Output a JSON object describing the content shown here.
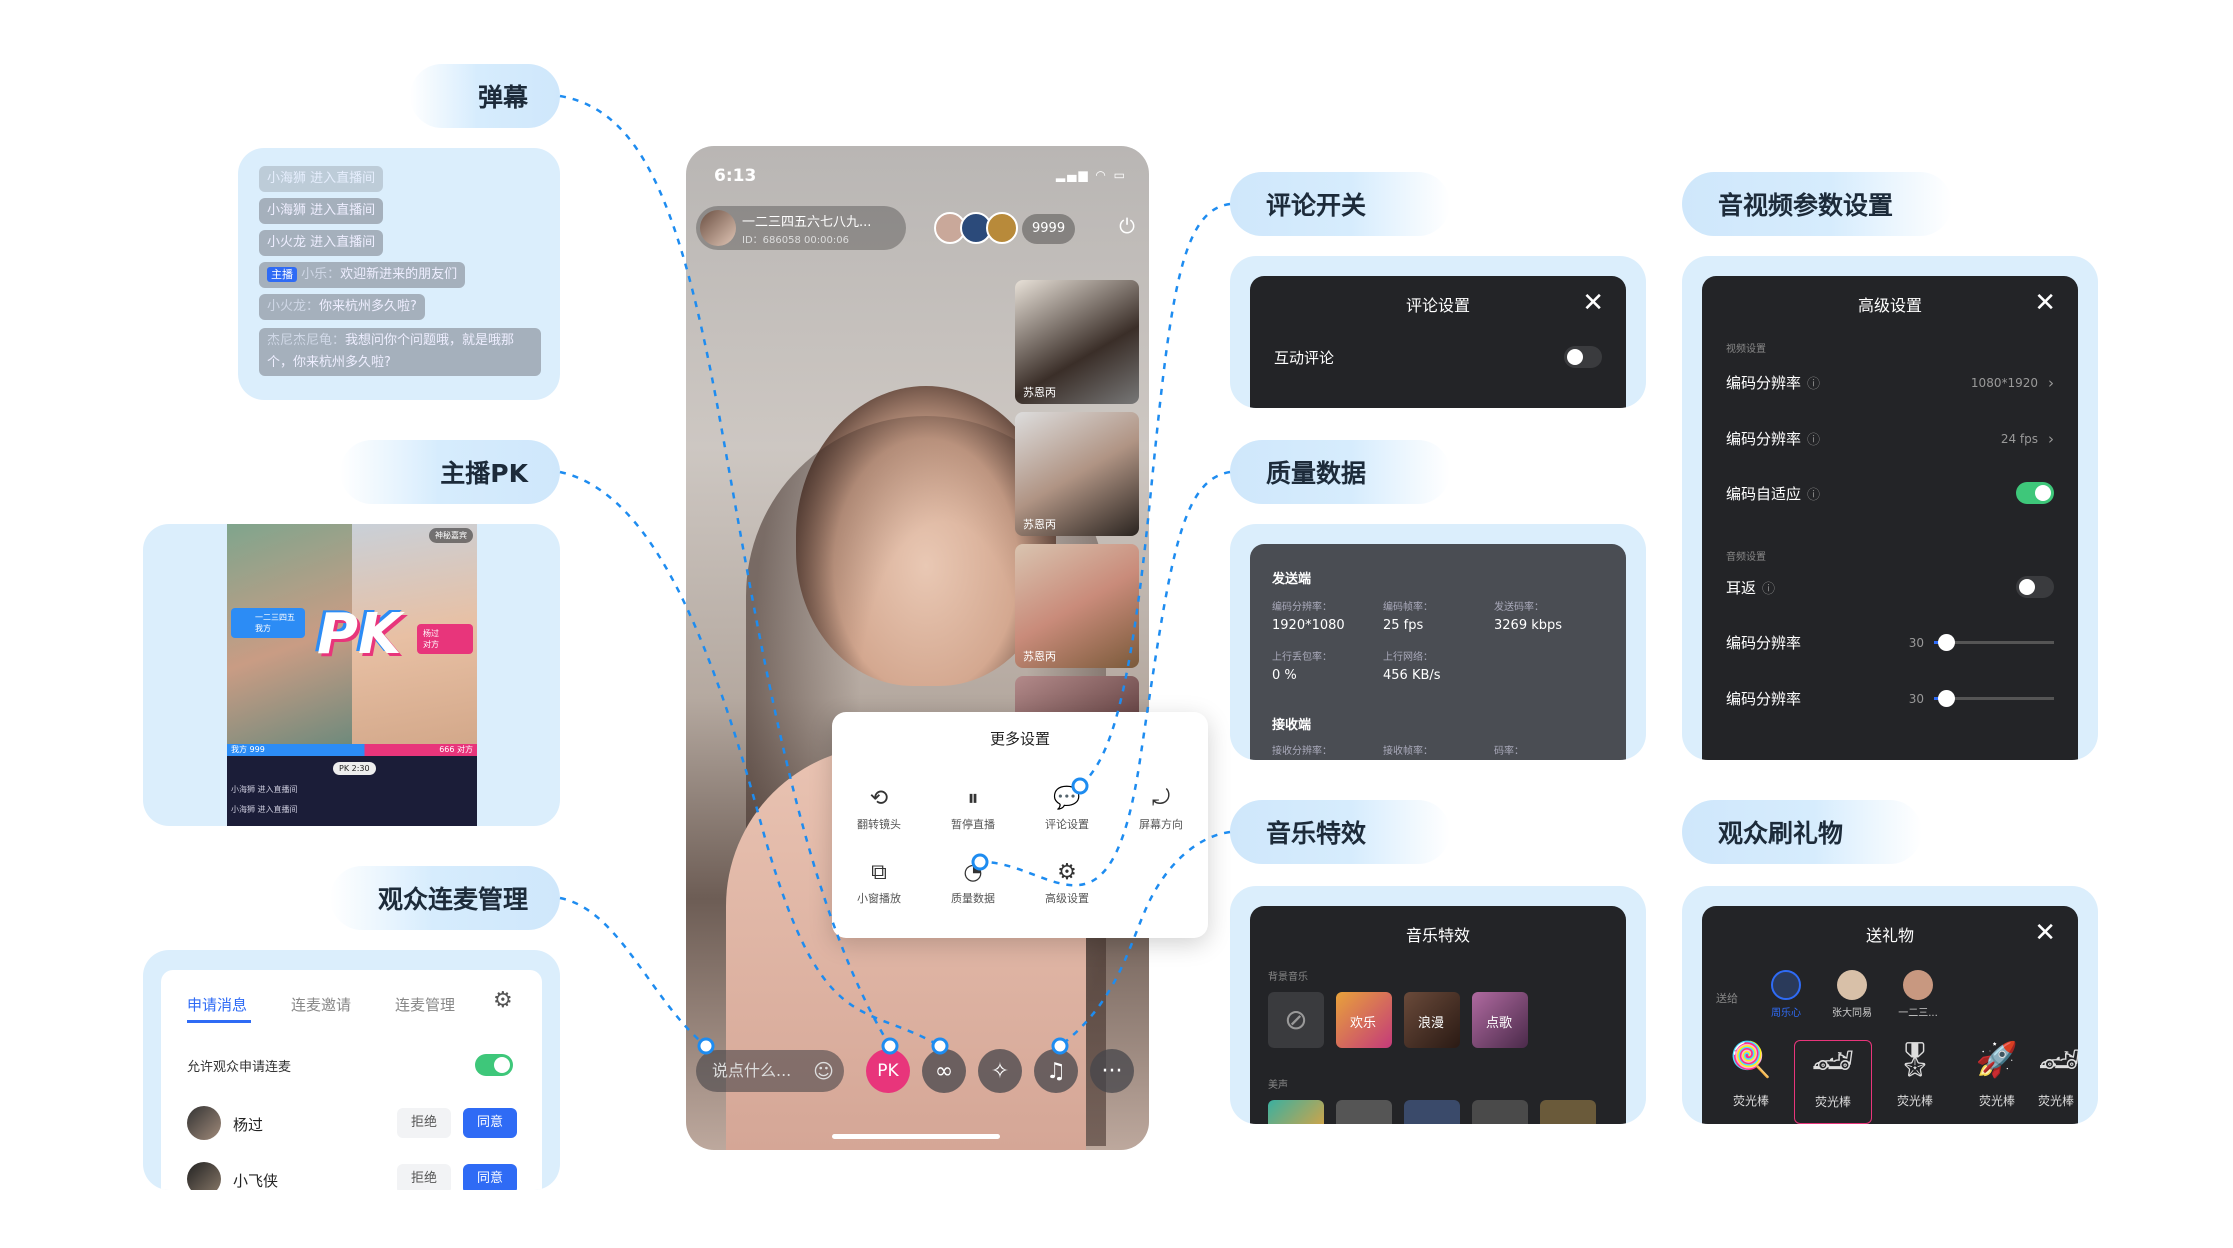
{
  "labels": {
    "danmu": "弹幕",
    "pk": "主播PK",
    "lianmai": "观众连麦管理",
    "comment_switch": "评论开关",
    "quality": "质量数据",
    "music": "音乐特效",
    "av_settings": "音视频参数设置",
    "gift": "观众刷礼物"
  },
  "danmu": {
    "messages": [
      {
        "text": "小海狮 进入直播间"
      },
      {
        "text": "小海狮 进入直播间"
      },
      {
        "text": "小火龙 进入直播间"
      },
      {
        "badge": "主播",
        "name": "小乐：",
        "text": "欢迎新进来的朋友们"
      },
      {
        "name": "小火龙：",
        "text": "你来杭州多久啦?"
      },
      {
        "name": "杰尼杰尼龟：",
        "text": "我想问你个问题哦，就是哦那个，你来杭州多久啦?"
      }
    ]
  },
  "pk": {
    "top_tag": "神秘嘉宾",
    "left_host": "一二三四五",
    "left_sub": "我方",
    "right_host": "杨过",
    "right_sub": "对方",
    "logo": "PK",
    "my_score": "我方 999",
    "their_score": "666 对方",
    "timer": "PK 2:30",
    "msgs": [
      "小海狮 进入直播间",
      "小海狮 进入直播间"
    ]
  },
  "lianmai": {
    "tabs": [
      "申请消息",
      "连麦邀请",
      "连麦管理"
    ],
    "allow_label": "允许观众申请连麦",
    "allow_on": true,
    "users": [
      {
        "name": "杨过",
        "reject": "拒绝",
        "accept": "同意"
      },
      {
        "name": "小飞侠",
        "reject": "拒绝",
        "accept": "同意"
      }
    ]
  },
  "phone": {
    "time": "6:13",
    "room_title": "一二三四五六七八九...",
    "room_id": "ID：686058",
    "room_time": "00:00:06",
    "viewers": "9999",
    "guests": [
      "苏恩丙",
      "苏恩丙",
      "苏恩丙"
    ],
    "input_placeholder": "说点什么...",
    "pk_btn": "PK",
    "menu": {
      "title": "更多设置",
      "items": [
        "翻转镜头",
        "暂停直播",
        "评论设置",
        "屏幕方向",
        "小窗播放",
        "质量数据",
        "高级设置"
      ]
    }
  },
  "comment": {
    "title": "评论设置",
    "row": "互动评论",
    "on": false
  },
  "quality": {
    "send_title": "发送端",
    "send": [
      {
        "k": "编码分辨率：",
        "v": "1920*1080"
      },
      {
        "k": "编码帧率：",
        "v": "25 fps"
      },
      {
        "k": "发送码率：",
        "v": "3269 kbps"
      },
      {
        "k": "上行丢包率：",
        "v": "0 %"
      },
      {
        "k": "上行网络：",
        "v": "456 KB/s"
      }
    ],
    "recv_title": "接收端",
    "recv": [
      "接收分辨率：",
      "接收帧率：",
      "码率："
    ]
  },
  "music": {
    "title": "音乐特效",
    "bg_label": "背景音乐",
    "tracks": [
      "欢乐",
      "浪漫",
      "点歌"
    ],
    "voice_label": "美声"
  },
  "advanced": {
    "title": "高级设置",
    "video_section": "视频设置",
    "audio_section": "音频设置",
    "rows": [
      {
        "label": "编码分辨率",
        "value": "1080*1920"
      },
      {
        "label": "编码分辨率",
        "value": "24 fps"
      },
      {
        "label": "编码自适应",
        "on": true
      },
      {
        "label": "耳返",
        "on": false
      },
      {
        "label": "编码分辨率",
        "value": "30",
        "level": 0.1
      },
      {
        "label": "编码分辨率",
        "value": "30",
        "level": 0.1
      }
    ]
  },
  "gift_panel": {
    "title": "送礼物",
    "to_label": "送给",
    "receivers": [
      "周乐心",
      "张大同易",
      "一二三..."
    ],
    "gifts": [
      "荧光棒",
      "荧光棒",
      "荧光棒",
      "荧光棒",
      "荧光棒"
    ]
  },
  "colors": {
    "accent": "#2f6bf5",
    "green": "#3ec77a",
    "pink": "#e8357b",
    "panel": "#dbeefc",
    "dark": "#232427"
  }
}
